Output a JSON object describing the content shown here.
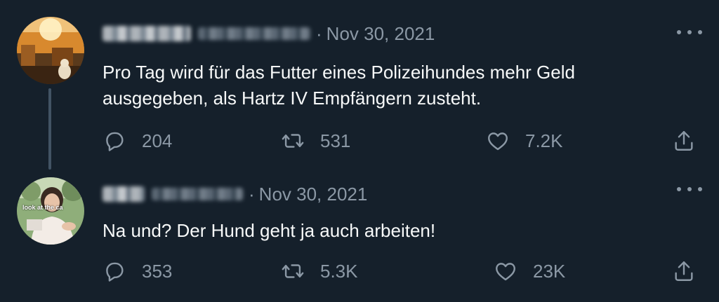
{
  "tweets": [
    {
      "date": "Nov 30, 2021",
      "text_line1": "Pro Tag wird für das Futter eines Polizeihundes mehr Geld",
      "text_line2": "ausgegeben, als Hartz IV Empfängern zusteht.",
      "replies": "204",
      "retweets": "531",
      "likes": "7.2K"
    },
    {
      "date": "Nov 30, 2021",
      "avatar_caption": "look at the ca",
      "text_line1": "Na und? Der Hund geht ja auch arbeiten!",
      "replies": "353",
      "retweets": "5.3K",
      "likes": "23K"
    }
  ],
  "separator": "·",
  "colors": {
    "background": "#15202b",
    "text": "#f7f9f9",
    "muted": "#8b98a5",
    "thread_line": "#425364"
  },
  "icons": [
    "reply-icon",
    "retweet-icon",
    "like-icon",
    "share-icon",
    "more-icon"
  ]
}
